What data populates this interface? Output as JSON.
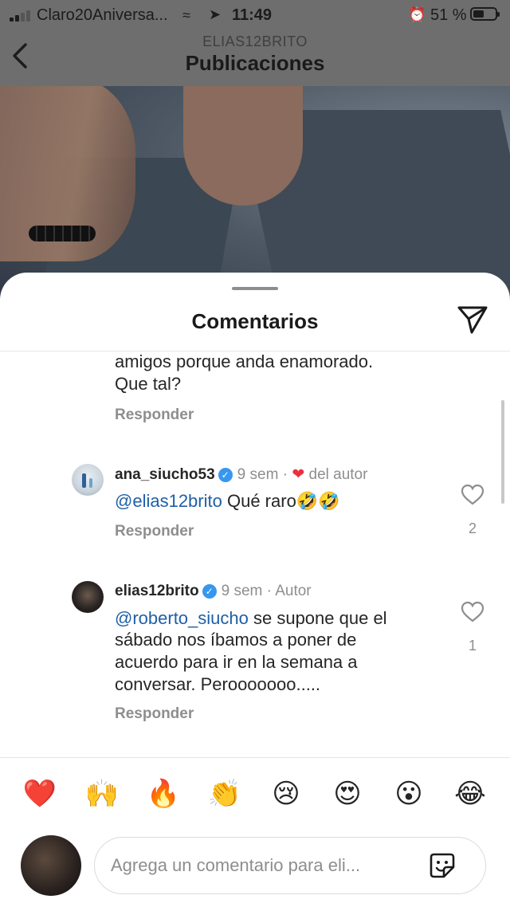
{
  "status": {
    "carrier": "Claro20Aniversa...",
    "time": "11:49",
    "battery_pct": "51 %",
    "battery_level": 0.51
  },
  "header": {
    "username": "ELIAS12BRITO",
    "title": "Publicaciones"
  },
  "sheet": {
    "title": "Comentarios"
  },
  "comments": [
    {
      "text_lines": [
        "amigos porque anda enamorado.",
        "Que tal?"
      ],
      "reply": "Responder"
    },
    {
      "username": "ana_siucho53",
      "time": "9 sem",
      "sep": "·",
      "author_like": "del autor",
      "mention": "@elias12brito",
      "text": "Qué raro",
      "emojis": "🤣🤣",
      "reply": "Responder",
      "likes": "2"
    },
    {
      "username": "elias12brito",
      "time": "9 sem",
      "sep": "·",
      "tag": "Autor",
      "mention": "@roberto_siucho",
      "text_first": " se supone que el",
      "text_lines": [
        "sábado nos íbamos a poner de",
        "acuerdo para ir en la semana a",
        "conversar. Perooooooo....."
      ],
      "reply": "Responder",
      "likes": "1"
    }
  ],
  "emoji_bar": [
    "❤️",
    "🙌",
    "🔥",
    "👏",
    "😢",
    "😍",
    "😮",
    "😂"
  ],
  "composer": {
    "placeholder": "Agrega un comentario para eli..."
  },
  "icons": {
    "back": "chevron-left-icon",
    "send": "paper-plane-icon",
    "like": "heart-outline-icon",
    "sticker": "sticker-icon"
  }
}
